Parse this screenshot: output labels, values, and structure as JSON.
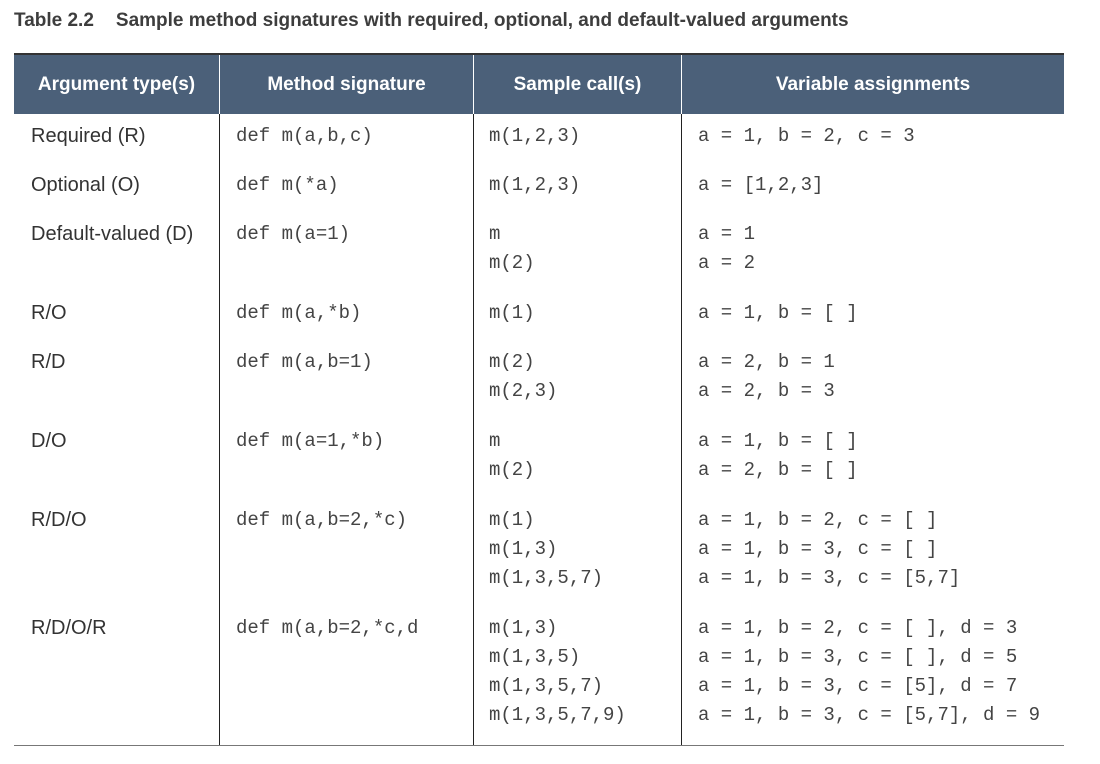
{
  "caption": {
    "number": "Table 2.2",
    "title": "Sample method signatures with required, optional, and default-valued arguments"
  },
  "headers": [
    "Argument type(s)",
    "Method signature",
    "Sample call(s)",
    "Variable assignments"
  ],
  "rows": [
    {
      "type": "Required (R)",
      "signature": "def m(a,b,c)",
      "calls": [
        "m(1,2,3)"
      ],
      "assignments": [
        "a = 1, b = 2, c = 3"
      ]
    },
    {
      "type": "Optional (O)",
      "signature": "def m(*a)",
      "calls": [
        "m(1,2,3)"
      ],
      "assignments": [
        "a = [1,2,3]"
      ]
    },
    {
      "type": "Default-valued (D)",
      "signature": "def m(a=1)",
      "calls": [
        "m",
        "m(2)"
      ],
      "assignments": [
        "a = 1",
        "a = 2"
      ]
    },
    {
      "type": "R/O",
      "signature": "def m(a,*b)",
      "calls": [
        "m(1)"
      ],
      "assignments": [
        "a = 1, b = [ ]"
      ]
    },
    {
      "type": "R/D",
      "signature": "def m(a,b=1)",
      "calls": [
        "m(2)",
        "m(2,3)"
      ],
      "assignments": [
        "a = 2, b = 1",
        "a = 2, b = 3"
      ]
    },
    {
      "type": "D/O",
      "signature": "def m(a=1,*b)",
      "calls": [
        "m",
        "m(2)"
      ],
      "assignments": [
        "a = 1, b = [ ]",
        "a = 2, b = [ ]"
      ]
    },
    {
      "type": "R/D/O",
      "signature": "def m(a,b=2,*c)",
      "calls": [
        "m(1)",
        "m(1,3)",
        "m(1,3,5,7)"
      ],
      "assignments": [
        "a = 1, b = 2, c = [ ]",
        "a = 1, b = 3, c = [ ]",
        "a = 1, b = 3, c = [5,7]"
      ]
    },
    {
      "type": "R/D/O/R",
      "signature": "def m(a,b=2,*c,d",
      "calls": [
        "m(1,3)",
        "m(1,3,5)",
        "m(1,3,5,7)",
        "m(1,3,5,7,9)"
      ],
      "assignments": [
        "a = 1, b = 2, c = [ ], d = 3",
        "a = 1, b = 3, c = [ ], d = 5",
        "a = 1, b = 3, c = [5], d = 7",
        "a = 1, b = 3, c = [5,7], d = 9"
      ]
    }
  ]
}
